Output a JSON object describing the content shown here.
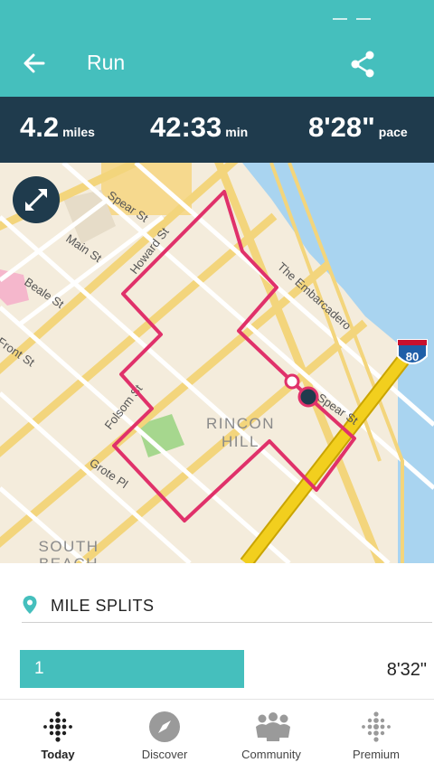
{
  "header": {
    "title": "Run",
    "back_icon": "arrow-left-icon",
    "share_icon": "share-icon"
  },
  "stats": {
    "distance_value": "4.2",
    "distance_unit": "miles",
    "duration_value": "42:33",
    "duration_unit": "min",
    "pace_value": "8'28\"",
    "pace_unit": "pace"
  },
  "map": {
    "streets": [
      "Spear St",
      "Howard St",
      "Main St",
      "Beale St",
      "Front St",
      "The Embarcadero",
      "Folsom St",
      "Grote Pl",
      "Spear St"
    ],
    "neighborhood": [
      "RINCON",
      "HILL"
    ],
    "neighborhood2": [
      "SOUTH",
      "BEACH"
    ],
    "highway_shield": "80",
    "route_color": "#e0316a"
  },
  "splits": {
    "title": "MILE SPLITS",
    "rows": [
      {
        "mile": "1",
        "pace": "8'32\""
      }
    ]
  },
  "tabs": [
    {
      "label": "Today",
      "icon": "dots-icon",
      "active": true
    },
    {
      "label": "Discover",
      "icon": "compass-icon",
      "active": false
    },
    {
      "label": "Community",
      "icon": "community-icon",
      "active": false
    },
    {
      "label": "Premium",
      "icon": "premium-dots-icon",
      "active": false
    }
  ],
  "colors": {
    "accent": "#45bfbd",
    "stats_bg": "#1f3b4d",
    "route": "#e0316a"
  }
}
